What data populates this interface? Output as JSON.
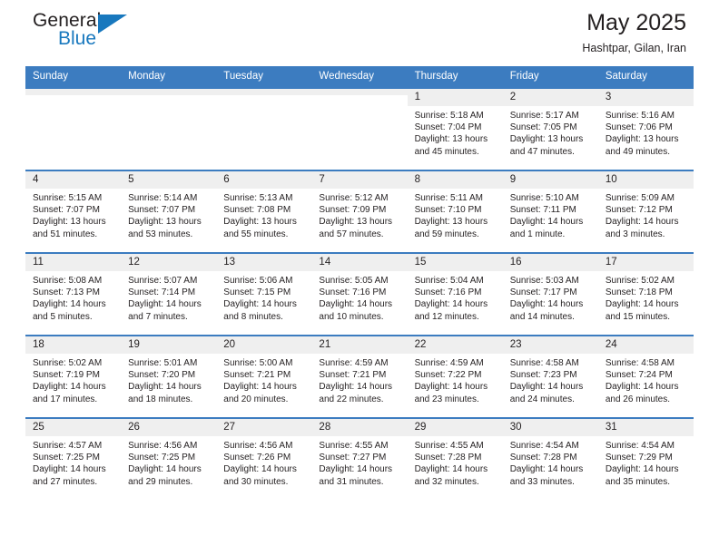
{
  "brand": {
    "name_top": "General",
    "name_bottom": "Blue",
    "accent_color": "#1878be",
    "triangle_icon": "triangle-icon"
  },
  "header": {
    "title": "May 2025",
    "location": "Hashtpar, Gilan, Iran"
  },
  "theme": {
    "header_row_bg": "#3c7cc0",
    "daynum_bg": "#efefef",
    "text_color": "#231f20"
  },
  "weekdays": [
    "Sunday",
    "Monday",
    "Tuesday",
    "Wednesday",
    "Thursday",
    "Friday",
    "Saturday"
  ],
  "labels": {
    "sunrise_prefix": "Sunrise:",
    "sunset_prefix": "Sunset:",
    "daylight_prefix": "Daylight:"
  },
  "weeks": [
    [
      {
        "day": "",
        "empty": true
      },
      {
        "day": "",
        "empty": true
      },
      {
        "day": "",
        "empty": true
      },
      {
        "day": "",
        "empty": true
      },
      {
        "day": "1",
        "sunrise": "Sunrise: 5:18 AM",
        "sunset": "Sunset: 7:04 PM",
        "daylight": "Daylight: 13 hours and 45 minutes."
      },
      {
        "day": "2",
        "sunrise": "Sunrise: 5:17 AM",
        "sunset": "Sunset: 7:05 PM",
        "daylight": "Daylight: 13 hours and 47 minutes."
      },
      {
        "day": "3",
        "sunrise": "Sunrise: 5:16 AM",
        "sunset": "Sunset: 7:06 PM",
        "daylight": "Daylight: 13 hours and 49 minutes."
      }
    ],
    [
      {
        "day": "4",
        "sunrise": "Sunrise: 5:15 AM",
        "sunset": "Sunset: 7:07 PM",
        "daylight": "Daylight: 13 hours and 51 minutes."
      },
      {
        "day": "5",
        "sunrise": "Sunrise: 5:14 AM",
        "sunset": "Sunset: 7:07 PM",
        "daylight": "Daylight: 13 hours and 53 minutes."
      },
      {
        "day": "6",
        "sunrise": "Sunrise: 5:13 AM",
        "sunset": "Sunset: 7:08 PM",
        "daylight": "Daylight: 13 hours and 55 minutes."
      },
      {
        "day": "7",
        "sunrise": "Sunrise: 5:12 AM",
        "sunset": "Sunset: 7:09 PM",
        "daylight": "Daylight: 13 hours and 57 minutes."
      },
      {
        "day": "8",
        "sunrise": "Sunrise: 5:11 AM",
        "sunset": "Sunset: 7:10 PM",
        "daylight": "Daylight: 13 hours and 59 minutes."
      },
      {
        "day": "9",
        "sunrise": "Sunrise: 5:10 AM",
        "sunset": "Sunset: 7:11 PM",
        "daylight": "Daylight: 14 hours and 1 minute."
      },
      {
        "day": "10",
        "sunrise": "Sunrise: 5:09 AM",
        "sunset": "Sunset: 7:12 PM",
        "daylight": "Daylight: 14 hours and 3 minutes."
      }
    ],
    [
      {
        "day": "11",
        "sunrise": "Sunrise: 5:08 AM",
        "sunset": "Sunset: 7:13 PM",
        "daylight": "Daylight: 14 hours and 5 minutes."
      },
      {
        "day": "12",
        "sunrise": "Sunrise: 5:07 AM",
        "sunset": "Sunset: 7:14 PM",
        "daylight": "Daylight: 14 hours and 7 minutes."
      },
      {
        "day": "13",
        "sunrise": "Sunrise: 5:06 AM",
        "sunset": "Sunset: 7:15 PM",
        "daylight": "Daylight: 14 hours and 8 minutes."
      },
      {
        "day": "14",
        "sunrise": "Sunrise: 5:05 AM",
        "sunset": "Sunset: 7:16 PM",
        "daylight": "Daylight: 14 hours and 10 minutes."
      },
      {
        "day": "15",
        "sunrise": "Sunrise: 5:04 AM",
        "sunset": "Sunset: 7:16 PM",
        "daylight": "Daylight: 14 hours and 12 minutes."
      },
      {
        "day": "16",
        "sunrise": "Sunrise: 5:03 AM",
        "sunset": "Sunset: 7:17 PM",
        "daylight": "Daylight: 14 hours and 14 minutes."
      },
      {
        "day": "17",
        "sunrise": "Sunrise: 5:02 AM",
        "sunset": "Sunset: 7:18 PM",
        "daylight": "Daylight: 14 hours and 15 minutes."
      }
    ],
    [
      {
        "day": "18",
        "sunrise": "Sunrise: 5:02 AM",
        "sunset": "Sunset: 7:19 PM",
        "daylight": "Daylight: 14 hours and 17 minutes."
      },
      {
        "day": "19",
        "sunrise": "Sunrise: 5:01 AM",
        "sunset": "Sunset: 7:20 PM",
        "daylight": "Daylight: 14 hours and 18 minutes."
      },
      {
        "day": "20",
        "sunrise": "Sunrise: 5:00 AM",
        "sunset": "Sunset: 7:21 PM",
        "daylight": "Daylight: 14 hours and 20 minutes."
      },
      {
        "day": "21",
        "sunrise": "Sunrise: 4:59 AM",
        "sunset": "Sunset: 7:21 PM",
        "daylight": "Daylight: 14 hours and 22 minutes."
      },
      {
        "day": "22",
        "sunrise": "Sunrise: 4:59 AM",
        "sunset": "Sunset: 7:22 PM",
        "daylight": "Daylight: 14 hours and 23 minutes."
      },
      {
        "day": "23",
        "sunrise": "Sunrise: 4:58 AM",
        "sunset": "Sunset: 7:23 PM",
        "daylight": "Daylight: 14 hours and 24 minutes."
      },
      {
        "day": "24",
        "sunrise": "Sunrise: 4:58 AM",
        "sunset": "Sunset: 7:24 PM",
        "daylight": "Daylight: 14 hours and 26 minutes."
      }
    ],
    [
      {
        "day": "25",
        "sunrise": "Sunrise: 4:57 AM",
        "sunset": "Sunset: 7:25 PM",
        "daylight": "Daylight: 14 hours and 27 minutes."
      },
      {
        "day": "26",
        "sunrise": "Sunrise: 4:56 AM",
        "sunset": "Sunset: 7:25 PM",
        "daylight": "Daylight: 14 hours and 29 minutes."
      },
      {
        "day": "27",
        "sunrise": "Sunrise: 4:56 AM",
        "sunset": "Sunset: 7:26 PM",
        "daylight": "Daylight: 14 hours and 30 minutes."
      },
      {
        "day": "28",
        "sunrise": "Sunrise: 4:55 AM",
        "sunset": "Sunset: 7:27 PM",
        "daylight": "Daylight: 14 hours and 31 minutes."
      },
      {
        "day": "29",
        "sunrise": "Sunrise: 4:55 AM",
        "sunset": "Sunset: 7:28 PM",
        "daylight": "Daylight: 14 hours and 32 minutes."
      },
      {
        "day": "30",
        "sunrise": "Sunrise: 4:54 AM",
        "sunset": "Sunset: 7:28 PM",
        "daylight": "Daylight: 14 hours and 33 minutes."
      },
      {
        "day": "31",
        "sunrise": "Sunrise: 4:54 AM",
        "sunset": "Sunset: 7:29 PM",
        "daylight": "Daylight: 14 hours and 35 minutes."
      }
    ]
  ]
}
